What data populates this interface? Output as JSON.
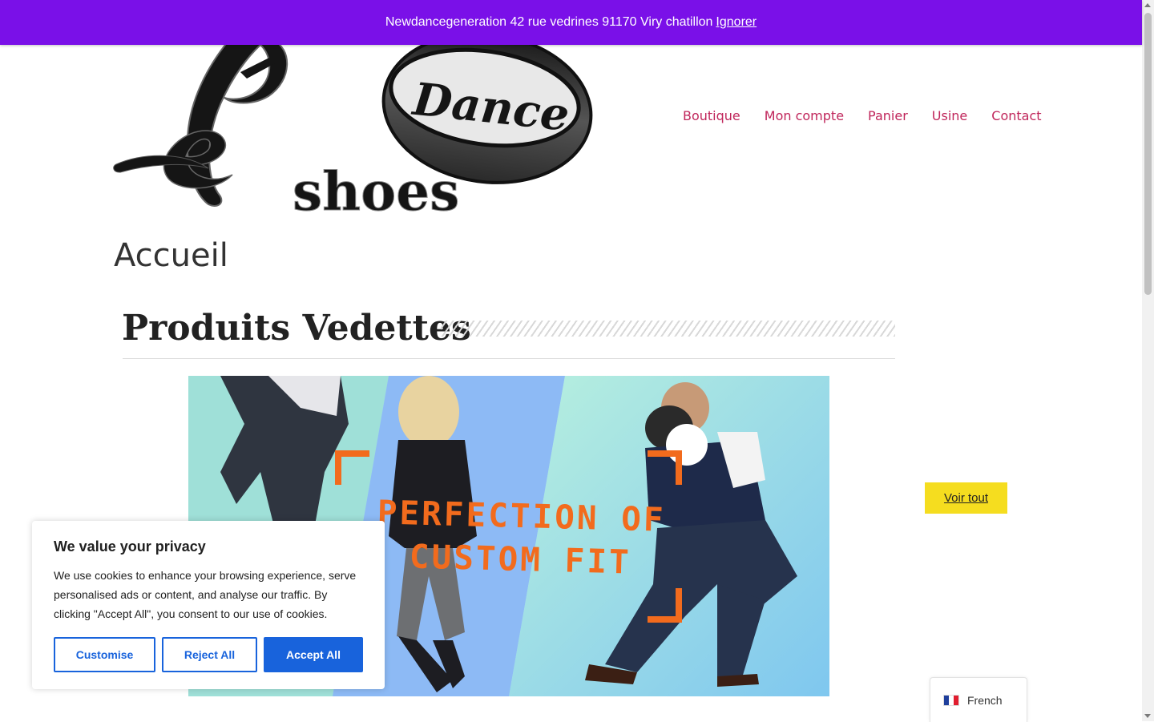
{
  "notice": {
    "text": "Newdancegeneration 42 rue vedrines 91170 Viry chatillon",
    "dismiss": "Ignorer"
  },
  "logo": {
    "alt": "Pé Dance shoes"
  },
  "nav": {
    "items": [
      "Boutique",
      "Mon compte",
      "Panier",
      "Usine",
      "Contact"
    ]
  },
  "page": {
    "title": "Accueil",
    "section_title": "Produits Vedettes",
    "see_all": "Voir tout"
  },
  "banner": {
    "line1": "PERFECTION OF",
    "line2": "CUSTOM FIT"
  },
  "cookie": {
    "title": "We value your privacy",
    "body": "We use cookies to enhance your browsing experience, serve personalised ads or content, and analyse our traffic. By clicking \"Accept All\", you consent to our use of cookies.",
    "customise": "Customise",
    "reject": "Reject All",
    "accept": "Accept All"
  },
  "language": {
    "current": "French",
    "flag": "fr-flag-icon"
  },
  "colors": {
    "notice_bg": "#7a10e8",
    "nav_link": "#c0265b",
    "see_all_bg": "#f5dd1f",
    "cookie_accent": "#1863dc",
    "banner_text": "#f26b1d"
  }
}
